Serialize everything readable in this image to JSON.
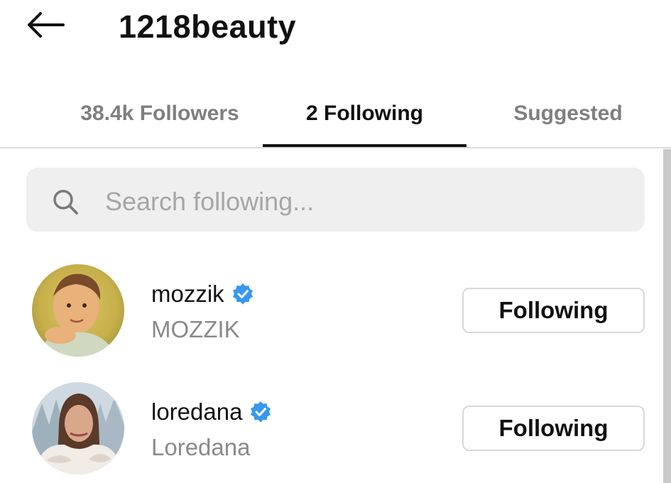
{
  "header": {
    "title": "1218beauty",
    "back_icon": "arrow-left-icon"
  },
  "tabs": [
    {
      "label": "38.4k Followers",
      "active": false
    },
    {
      "label": "2 Following",
      "active": true
    },
    {
      "label": "Suggested",
      "active": false
    }
  ],
  "search": {
    "placeholder": "Search following...",
    "value": "",
    "icon": "search-icon"
  },
  "following": [
    {
      "username": "mozzik",
      "full_name": "MOZZIK",
      "verified": true,
      "button_label": "Following"
    },
    {
      "username": "loredana",
      "full_name": "Loredana",
      "verified": true,
      "button_label": "Following"
    }
  ],
  "colors": {
    "verified_badge": "#3897f0",
    "tab_inactive": "#7f7f7f",
    "search_background": "#efefef"
  }
}
